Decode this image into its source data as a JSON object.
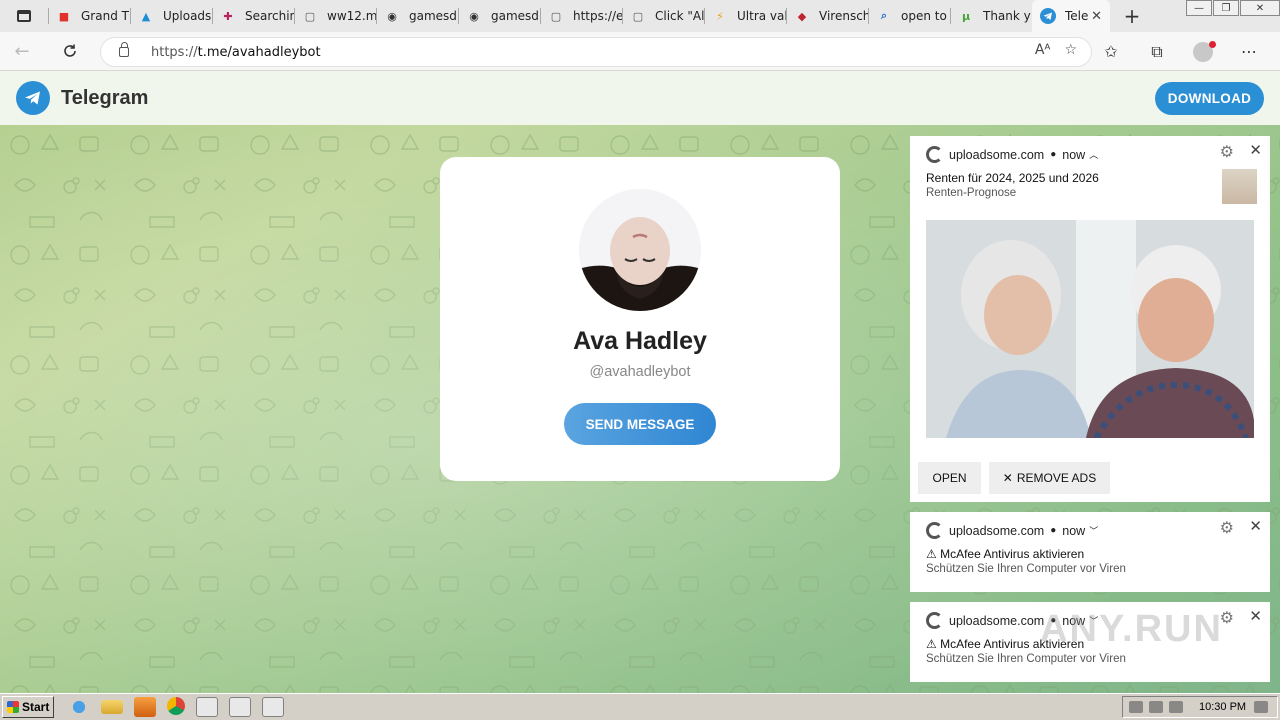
{
  "browser": {
    "tabs": [
      {
        "title": "Grand Th",
        "icon": "gift-icon",
        "color": "#e0312b"
      },
      {
        "title": "Uploads",
        "icon": "upload-icon",
        "color": "#1a8fd6"
      },
      {
        "title": "Searchin",
        "icon": "puzzle-icon",
        "color": "#b8245e"
      },
      {
        "title": "ww12.m",
        "icon": "page-icon",
        "color": "#555555"
      },
      {
        "title": "gamesd",
        "icon": "gamepad-icon",
        "color": "#333333"
      },
      {
        "title": "gamesd",
        "icon": "gamepad-icon",
        "color": "#333333"
      },
      {
        "title": "https://e",
        "icon": "page-icon",
        "color": "#555555"
      },
      {
        "title": "Click \"Al",
        "icon": "page-icon",
        "color": "#555555"
      },
      {
        "title": "Ultra val",
        "icon": "bolt-icon",
        "color": "#f0a020"
      },
      {
        "title": "Virensch",
        "icon": "shield-icon",
        "color": "#c0242c"
      },
      {
        "title": "open to",
        "icon": "search-icon",
        "color": "#2a6fd6"
      },
      {
        "title": "Thank y",
        "icon": "utorrent-icon",
        "color": "#4aa53a"
      }
    ],
    "active_tab": {
      "title": "Tele",
      "icon": "telegram-icon",
      "color": "#2b8fd6"
    },
    "url_prefix": "https://",
    "url_host": "t.me",
    "url_path": "/avahadleybot"
  },
  "telegram": {
    "brand": "Telegram",
    "download_label": "DOWNLOAD",
    "profile": {
      "name": "Ava Hadley",
      "username": "@avahadleybot",
      "send_label": "SEND MESSAGE"
    }
  },
  "notifications": [
    {
      "source": "uploadsome.com",
      "time": "now",
      "title": "Renten für 2024, 2025 und 2026",
      "subtitle": "Renten-Prognose",
      "open_label": "OPEN",
      "remove_label": "REMOVE ADS"
    },
    {
      "source": "uploadsome.com",
      "time": "now",
      "title": "⚠ McAfee Antivirus aktivieren",
      "subtitle": "Schützen Sie Ihren Computer vor Viren"
    },
    {
      "source": "uploadsome.com",
      "time": "now",
      "title": "⚠ McAfee Antivirus aktivieren",
      "subtitle": "Schützen Sie Ihren Computer vor Viren"
    }
  ],
  "watermark": "ANY.RUN",
  "taskbar": {
    "start_label": "Start",
    "clock": "10:30 PM"
  },
  "colors": {
    "telegram_blue": "#2b8fd6",
    "pattern_green": "#a8cc92"
  }
}
